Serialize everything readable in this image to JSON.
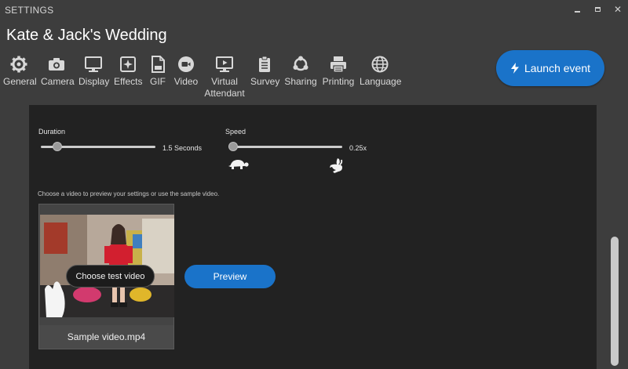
{
  "window": {
    "title": "SETTINGS"
  },
  "event": {
    "title": "Kate & Jack's Wedding"
  },
  "toolbar": {
    "items": [
      {
        "label": "General",
        "icon": "gear-icon"
      },
      {
        "label": "Camera",
        "icon": "camera-icon"
      },
      {
        "label": "Display",
        "icon": "monitor-icon"
      },
      {
        "label": "Effects",
        "icon": "effects-icon"
      },
      {
        "label": "GIF",
        "icon": "gif-file-icon"
      },
      {
        "label": "Video",
        "icon": "video-camera-icon"
      },
      {
        "label": "Virtual",
        "label2": "Attendant",
        "icon": "virtual-attendant-icon"
      },
      {
        "label": "Survey",
        "icon": "clipboard-icon"
      },
      {
        "label": "Sharing",
        "icon": "sharing-icon"
      },
      {
        "label": "Printing",
        "icon": "printer-icon"
      },
      {
        "label": "Language",
        "icon": "globe-icon"
      }
    ]
  },
  "launch": {
    "label": "Launch event",
    "icon": "lightning-icon"
  },
  "settings": {
    "duration": {
      "label": "Duration",
      "value_text": "1.5 Seconds",
      "level": 0.1
    },
    "speed": {
      "label": "Speed",
      "value_text": "0.25x",
      "level": 0.0,
      "slow_icon": "turtle-icon",
      "fast_icon": "rabbit-icon"
    }
  },
  "preview": {
    "hint": "Choose a video to preview your settings or use the sample video.",
    "filename": "Sample video.mp4",
    "choose_label": "Choose test video",
    "preview_label": "Preview"
  },
  "colors": {
    "accent": "#1a73c9",
    "panel": "#222222",
    "chrome": "#3d3d3d"
  }
}
